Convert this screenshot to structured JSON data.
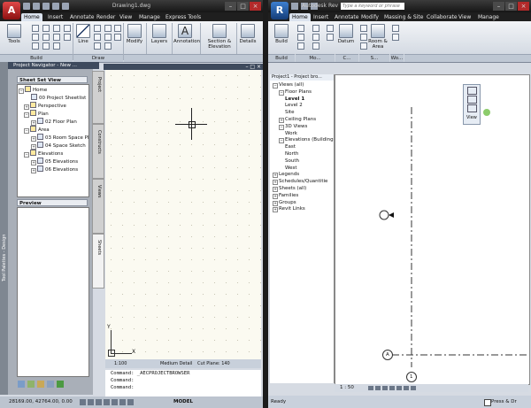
{
  "left": {
    "title": "Drawing1.dwg",
    "tabs": [
      "Home",
      "Insert",
      "Annotate",
      "Render",
      "View",
      "Manage",
      "Express Tools"
    ],
    "ribbon_buttons": [
      "Tools",
      "Line",
      "Modify",
      "Layers",
      "Annotation",
      "Section & Elevation",
      "Details"
    ],
    "ribbon_groups": [
      "Build",
      "Draw"
    ],
    "palette_title": "Tool Palettes - Design",
    "navigator_title": "Project Navigator - New ...",
    "sheet_set_view_label": "Sheet Set View",
    "sheet_tree": [
      {
        "label": "Home",
        "indent": 0
      },
      {
        "label": "00 Project Sheetlist",
        "indent": 2
      },
      {
        "label": "Perspective",
        "indent": 1
      },
      {
        "label": "Plan",
        "indent": 1
      },
      {
        "label": "02 Floor Plan",
        "indent": 2
      },
      {
        "label": "Area",
        "indent": 1
      },
      {
        "label": "03 Room Space Pl",
        "indent": 2
      },
      {
        "label": "04 Space Sketch",
        "indent": 2
      },
      {
        "label": "Elevations",
        "indent": 1
      },
      {
        "label": "05 Elevations",
        "indent": 2
      },
      {
        "label": "06 Elevations",
        "indent": 2
      }
    ],
    "side_tabs": [
      "Project",
      "Constructs",
      "Views",
      "Sheets"
    ],
    "preview_label": "Preview",
    "scale": "1:100",
    "detail_level": "Medium Detail",
    "cut_plane": "Cut Plane: 140",
    "commands": [
      "Command: _AECPROJECTBROWSER",
      "Command:",
      "Command:"
    ],
    "coordinates": "28169.00, 42764.00, 0.00",
    "model_label": "MODEL",
    "ucs_x": "X",
    "ucs_y": "Y"
  },
  "right": {
    "title": "Autodesk Rev",
    "search_placeholder": "Type a keyword or phrase",
    "tabs": [
      "Home",
      "Insert",
      "Annotate",
      "Modify",
      "Massing & Site",
      "Collaborate",
      "View",
      "Manage"
    ],
    "ribbon_buttons": [
      "Build",
      "Datum",
      "Room & Area"
    ],
    "ribbon_group_labels": [
      "Build",
      "Mo...",
      "C...",
      "S...",
      "Wo..."
    ],
    "browser_title": "Project1 - Project bro...",
    "browser_tree": [
      {
        "label": "Views (all)",
        "indent": 0
      },
      {
        "label": "Floor Plans",
        "indent": 1
      },
      {
        "label": "Level 1",
        "indent": 2,
        "bold": true
      },
      {
        "label": "Level 2",
        "indent": 2
      },
      {
        "label": "Site",
        "indent": 2
      },
      {
        "label": "Ceiling Plans",
        "indent": 1
      },
      {
        "label": "3D Views",
        "indent": 1
      },
      {
        "label": "Work",
        "indent": 2
      },
      {
        "label": "Elevations (Building",
        "indent": 1
      },
      {
        "label": "East",
        "indent": 2
      },
      {
        "label": "North",
        "indent": 2
      },
      {
        "label": "South",
        "indent": 2
      },
      {
        "label": "West",
        "indent": 2
      },
      {
        "label": "Legends",
        "indent": 0
      },
      {
        "label": "Schedules/Quantitie",
        "indent": 0
      },
      {
        "label": "Sheets (all)",
        "indent": 0
      },
      {
        "label": "Families",
        "indent": 0
      },
      {
        "label": "Groups",
        "indent": 0
      },
      {
        "label": "Revit Links",
        "indent": 0
      }
    ],
    "view_label": "View",
    "grid_a": "A",
    "grid_1": "1",
    "scale": "1 : 50",
    "status": "Ready",
    "press_drag": "Press & Dr"
  },
  "colors": {
    "autocad_red": "#b3262a",
    "drawing_bg": "#fbfaf1",
    "navigator_header": "#3e4a5d"
  }
}
